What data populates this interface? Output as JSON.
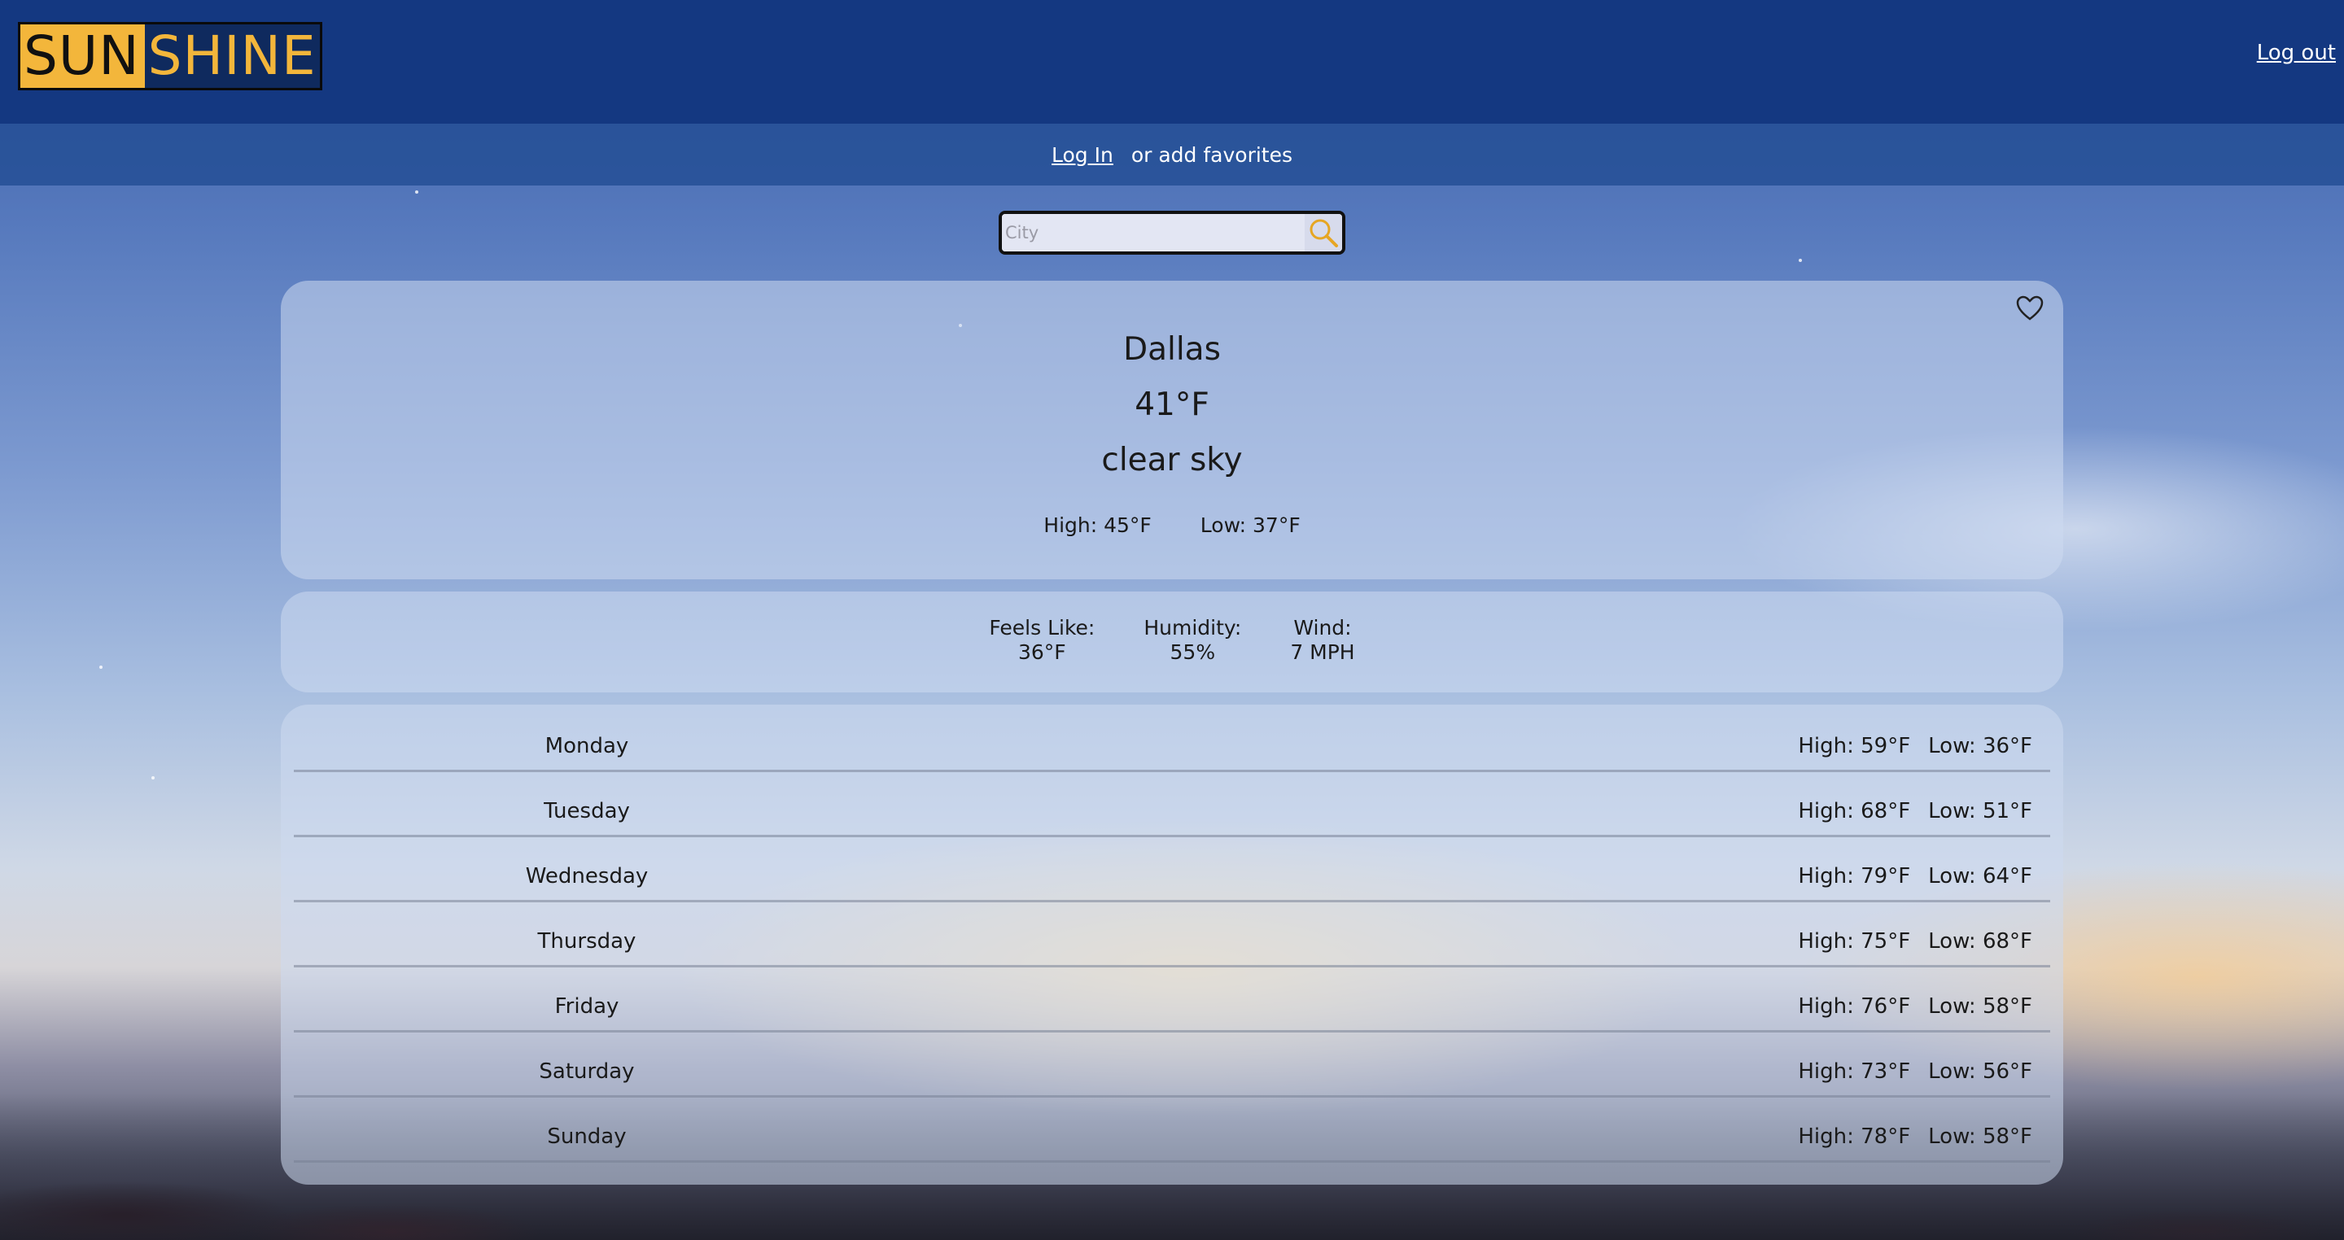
{
  "header": {
    "logo_sun": "SUN",
    "logo_shine": "SHINE",
    "logout_label": "Log out"
  },
  "subbar": {
    "login_label": "Log In",
    "suffix": "or add favorites"
  },
  "search": {
    "placeholder": "City",
    "value": ""
  },
  "current": {
    "city": "Dallas",
    "temp": "41°F",
    "description": "clear sky",
    "high": "High: 45°F",
    "low": "Low: 37°F"
  },
  "details": {
    "feels_like_label": "Feels Like:",
    "feels_like_value": "36°F",
    "humidity_label": "Humidity:",
    "humidity_value": "55%",
    "wind_label": "Wind:",
    "wind_value": "7 MPH"
  },
  "forecast": [
    {
      "day": "Monday",
      "high": "High: 59°F",
      "low": "Low: 36°F"
    },
    {
      "day": "Tuesday",
      "high": "High: 68°F",
      "low": "Low: 51°F"
    },
    {
      "day": "Wednesday",
      "high": "High: 79°F",
      "low": "Low: 64°F"
    },
    {
      "day": "Thursday",
      "high": "High: 75°F",
      "low": "Low: 68°F"
    },
    {
      "day": "Friday",
      "high": "High: 76°F",
      "low": "Low: 58°F"
    },
    {
      "day": "Saturday",
      "high": "High: 73°F",
      "low": "Low: 56°F"
    },
    {
      "day": "Sunday",
      "high": "High: 78°F",
      "low": "Low: 58°F"
    }
  ],
  "colors": {
    "header_bg": "#143881",
    "logo_gold": "#f3b63b",
    "subbar_bg": "#2b5599"
  },
  "icons": {
    "search": "magnifier-icon",
    "favorite": "heart-outline-icon"
  }
}
